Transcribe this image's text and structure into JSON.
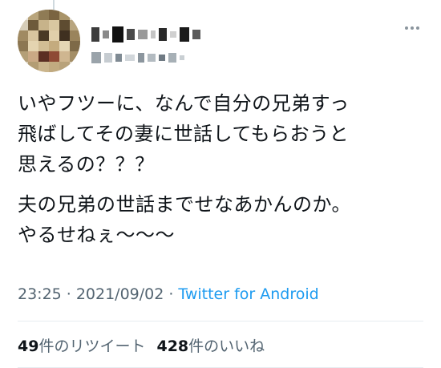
{
  "tweet": {
    "paragraphs": [
      "いやフツーに、なんで自分の兄弟すっ\n飛ばしてその妻に世話してもらおうと\n思えるの？？？",
      "夫の兄弟の世話までせなあかんのか。\nやるせねぇ〜〜〜"
    ]
  },
  "meta": {
    "time": "23:25",
    "separator": "·",
    "date": "2021/09/02",
    "source": "Twitter for Android"
  },
  "stats": {
    "retweets": {
      "count": "49",
      "label": "件のリツイート"
    },
    "likes": {
      "count": "428",
      "label": "件のいいね"
    }
  },
  "colors": {
    "text": "#0f1419",
    "secondary": "#536471",
    "link": "#1d9bf0",
    "divider": "#e6ecf0"
  },
  "icons": {
    "more": "more-horizontal-icon"
  }
}
